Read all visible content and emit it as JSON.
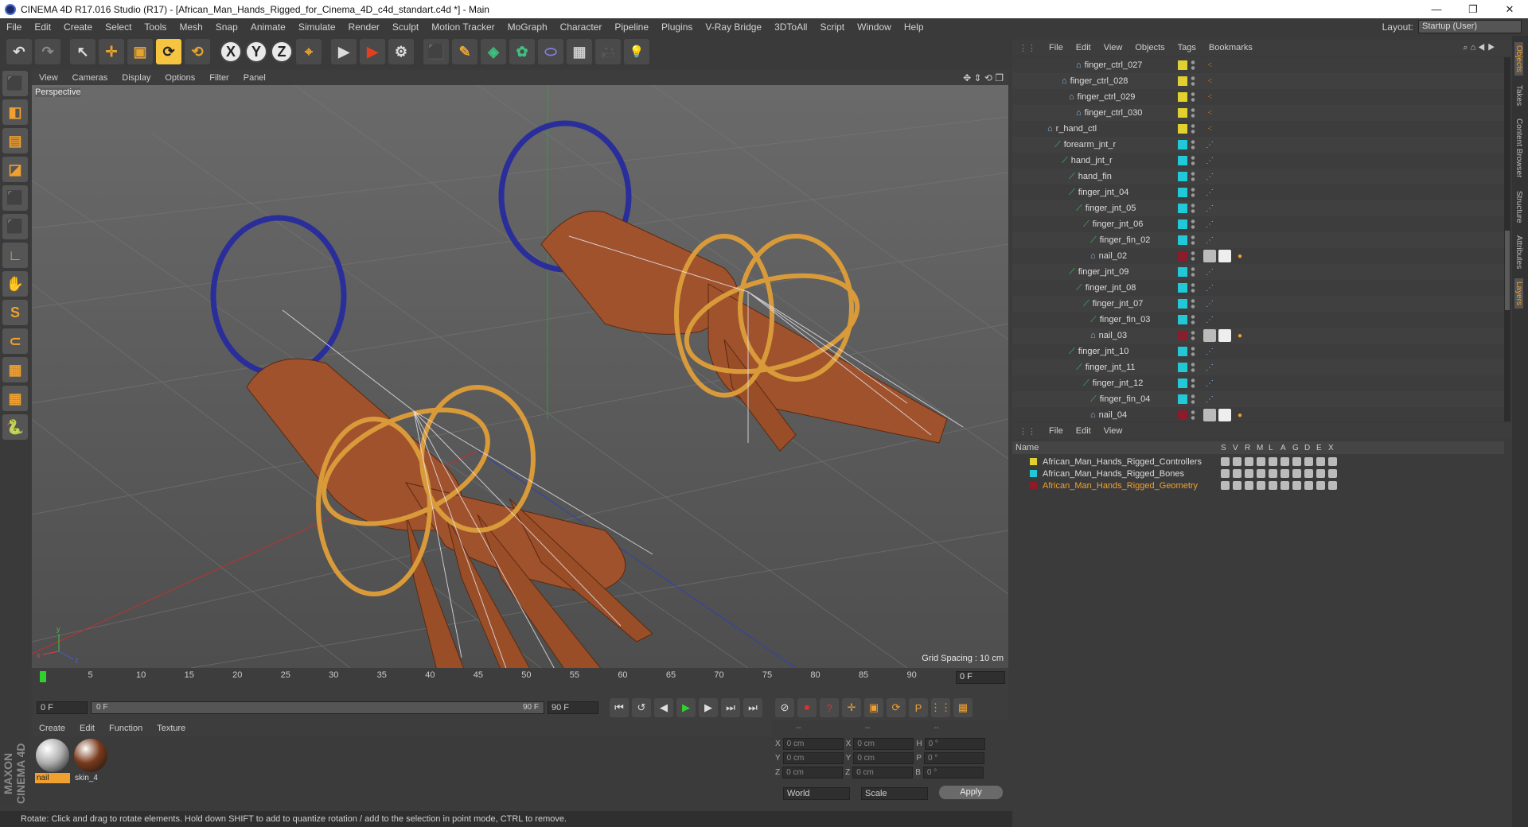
{
  "window": {
    "title": "CINEMA 4D R17.016 Studio (R17) - [African_Man_Hands_Rigged_for_Cinema_4D_c4d_standart.c4d *] - Main",
    "minimize": "—",
    "maximize": "❐",
    "close": "✕"
  },
  "menubar": [
    "File",
    "Edit",
    "Create",
    "Select",
    "Tools",
    "Mesh",
    "Snap",
    "Animate",
    "Simulate",
    "Render",
    "Sculpt",
    "Motion Tracker",
    "MoGraph",
    "Character",
    "Pipeline",
    "Plugins",
    "V-Ray Bridge",
    "3DToAll",
    "Script",
    "Window",
    "Help"
  ],
  "layout": {
    "label": "Layout:",
    "value": "Startup (User)"
  },
  "toolbar": {
    "undo": "↶",
    "redo": "↷",
    "select": "↖",
    "move": "✛",
    "scale": "▣",
    "rotate": "⟳",
    "rotate2": "⟲",
    "x": "X",
    "y": "Y",
    "z": "Z",
    "coord": "⌖",
    "render_view": "▶",
    "render_pic": "▶",
    "render_settings": "⚙",
    "cube": "⬛",
    "pen": "✎",
    "subdiv": "◈",
    "cloner": "✿",
    "deformer": "⬭",
    "floor": "▦",
    "camera": "🎥",
    "light": "💡"
  },
  "lefttools": [
    "⬛",
    "◧",
    "▤",
    "◪",
    "⬛",
    "⬛",
    "∟",
    "✋",
    "S",
    "⊂",
    "▦",
    "▦",
    "🐍"
  ],
  "viewport": {
    "menu": [
      "View",
      "Cameras",
      "Display",
      "Options",
      "Filter",
      "Panel"
    ],
    "label": "Perspective",
    "grid_spacing": "Grid Spacing : 10 cm",
    "nav_icons": "✥ ⇕ ⟲ ❐"
  },
  "timeline": {
    "ticks": [
      "0",
      "5",
      "10",
      "15",
      "20",
      "25",
      "30",
      "35",
      "40",
      "45",
      "50",
      "55",
      "60",
      "65",
      "70",
      "75",
      "80",
      "85",
      "90"
    ],
    "current": "0 F"
  },
  "transport": {
    "start": "0 F",
    "range_start": "0 F",
    "range_end": "90 F",
    "end": "90 F",
    "buttons": [
      "⏮",
      "↺",
      "◀",
      "▶",
      "▶",
      "⏭",
      "⏭"
    ],
    "keys": [
      "⊘",
      "⏺",
      "?",
      "✛",
      "▣",
      "⟳",
      "P",
      "⋮⋮",
      "▦"
    ]
  },
  "materials": {
    "menu": [
      "Create",
      "Edit",
      "Function",
      "Texture"
    ],
    "items": [
      {
        "name": "nail",
        "color": "#b0b0b0"
      },
      {
        "name": "skin_4",
        "color": "#7a3a1c"
      }
    ]
  },
  "coords": {
    "dashes": [
      "--",
      "--",
      "--"
    ],
    "rows": [
      {
        "a": "X",
        "av": "0 cm",
        "b": "X",
        "bv": "0 cm",
        "c": "H",
        "cv": "0 °"
      },
      {
        "a": "Y",
        "av": "0 cm",
        "b": "Y",
        "bv": "0 cm",
        "c": "P",
        "cv": "0 °"
      },
      {
        "a": "Z",
        "av": "0 cm",
        "b": "Z",
        "bv": "0 cm",
        "c": "B",
        "cv": "0 °"
      }
    ],
    "world": "World",
    "scale": "Scale",
    "apply": "Apply"
  },
  "status": "Rotate: Click and drag to rotate elements. Hold down SHIFT to add to quantize rotation / add to the selection in point mode, CTRL to remove.",
  "maxon": "MAXON CINEMA 4D",
  "objects": {
    "menu": [
      "File",
      "Edit",
      "View",
      "Objects",
      "Tags",
      "Bookmarks"
    ],
    "rows": [
      {
        "name": "finger_ctrl_027",
        "indent": 80,
        "color": "#e0d030",
        "kind": "ctrl"
      },
      {
        "name": "finger_ctrl_028",
        "indent": 62,
        "color": "#e0d030",
        "kind": "ctrl"
      },
      {
        "name": "finger_ctrl_029",
        "indent": 71,
        "color": "#e0d030",
        "kind": "ctrl"
      },
      {
        "name": "finger_ctrl_030",
        "indent": 80,
        "color": "#e0d030",
        "kind": "ctrl"
      },
      {
        "name": "r_hand_ctl",
        "indent": 44,
        "color": "#e0d030",
        "kind": "ctrl"
      },
      {
        "name": "forearm_jnt_r",
        "indent": 53,
        "color": "#20c8d8",
        "kind": "joint"
      },
      {
        "name": "hand_jnt_r",
        "indent": 62,
        "color": "#20c8d8",
        "kind": "joint"
      },
      {
        "name": "hand_fin",
        "indent": 71,
        "color": "#20c8d8",
        "kind": "joint"
      },
      {
        "name": "finger_jnt_04",
        "indent": 71,
        "color": "#20c8d8",
        "kind": "joint"
      },
      {
        "name": "finger_jnt_05",
        "indent": 80,
        "color": "#20c8d8",
        "kind": "joint"
      },
      {
        "name": "finger_jnt_06",
        "indent": 89,
        "color": "#20c8d8",
        "kind": "joint"
      },
      {
        "name": "finger_fin_02",
        "indent": 98,
        "color": "#20c8d8",
        "kind": "joint"
      },
      {
        "name": "nail_02",
        "indent": 98,
        "color": "#8a1c2c",
        "kind": "geo"
      },
      {
        "name": "finger_jnt_09",
        "indent": 71,
        "color": "#20c8d8",
        "kind": "joint"
      },
      {
        "name": "finger_jnt_08",
        "indent": 80,
        "color": "#20c8d8",
        "kind": "joint"
      },
      {
        "name": "finger_jnt_07",
        "indent": 89,
        "color": "#20c8d8",
        "kind": "joint"
      },
      {
        "name": "finger_fin_03",
        "indent": 98,
        "color": "#20c8d8",
        "kind": "joint"
      },
      {
        "name": "nail_03",
        "indent": 98,
        "color": "#8a1c2c",
        "kind": "geo"
      },
      {
        "name": "finger_jnt_10",
        "indent": 71,
        "color": "#20c8d8",
        "kind": "joint"
      },
      {
        "name": "finger_jnt_11",
        "indent": 80,
        "color": "#20c8d8",
        "kind": "joint"
      },
      {
        "name": "finger_jnt_12",
        "indent": 89,
        "color": "#20c8d8",
        "kind": "joint"
      },
      {
        "name": "finger_fin_04",
        "indent": 98,
        "color": "#20c8d8",
        "kind": "joint"
      },
      {
        "name": "nail_04",
        "indent": 98,
        "color": "#8a1c2c",
        "kind": "geo"
      }
    ]
  },
  "layers": {
    "menu": [
      "File",
      "Edit",
      "View"
    ],
    "header": {
      "name": "Name",
      "cols": [
        "S",
        "V",
        "R",
        "M",
        "L",
        "A",
        "G",
        "D",
        "E",
        "X"
      ]
    },
    "rows": [
      {
        "name": "African_Man_Hands_Rigged_Controllers",
        "color": "#e0d030",
        "text": "#dddddd"
      },
      {
        "name": "African_Man_Hands_Rigged_Bones",
        "color": "#20c8d8",
        "text": "#dddddd"
      },
      {
        "name": "African_Man_Hands_Rigged_Geometry",
        "color": "#8a1c2c",
        "text": "#f0a030"
      }
    ]
  },
  "sidetabs": [
    "Objects",
    "Takes",
    "Content Browser",
    "Structure",
    "Attributes",
    "Layers"
  ]
}
